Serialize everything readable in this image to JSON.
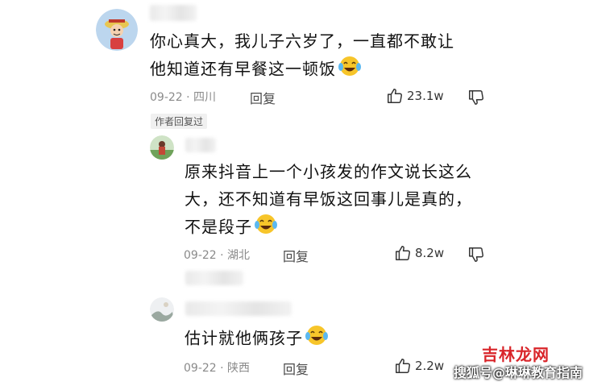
{
  "comments": [
    {
      "text_line1": "你心真大，我儿子六岁了，一直都不敢让",
      "text_line2": "他知道还有早餐这一顿饭",
      "date": "09-22",
      "location": "四川",
      "reply_label": "回复",
      "likes": "23.1w"
    }
  ],
  "author_tag": "作者回复过",
  "replies": [
    {
      "text_line1": "原来抖音上一个小孩发的作文说长这么",
      "text_line2": "大，还不知道有早饭这回事儿是真的，",
      "text_line3": "不是段子",
      "date": "09-22",
      "location": "湖北",
      "reply_label": "回复",
      "likes": "8.2w"
    },
    {
      "text_line1": "估计就他俩孩子",
      "date": "09-22",
      "location": "陕西",
      "reply_label": "回复",
      "likes": "2.2w"
    }
  ],
  "meta_separator": "·",
  "watermark": {
    "source": "搜狐号@琳琳教育指南",
    "site_name": "吉林龙网"
  },
  "icons": {
    "like": "thumbs-up-icon",
    "dislike": "thumbs-down-icon",
    "emoji": "laughing-crying-emoji"
  },
  "colors": {
    "text": "#111111",
    "meta": "#8a8a8a",
    "site_red": "#d9252a",
    "site_green": "#2a8f3a"
  }
}
